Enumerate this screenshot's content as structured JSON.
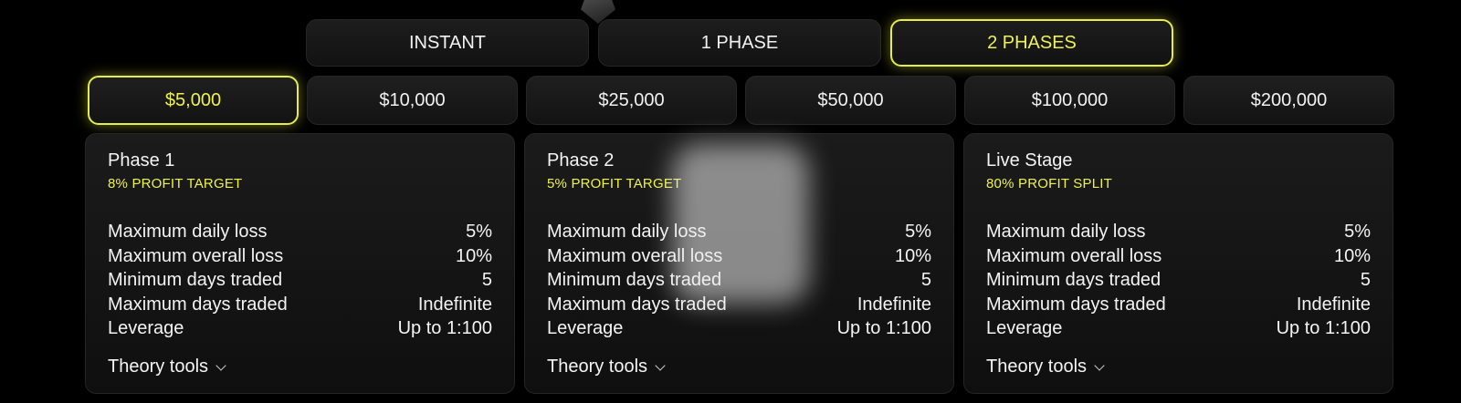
{
  "plan_tabs": [
    {
      "label": "INSTANT",
      "active": false
    },
    {
      "label": "1 PHASE",
      "active": false
    },
    {
      "label": "2 PHASES",
      "active": true
    }
  ],
  "amounts": [
    {
      "label": "$5,000",
      "active": true
    },
    {
      "label": "$10,000",
      "active": false
    },
    {
      "label": "$25,000",
      "active": false
    },
    {
      "label": "$50,000",
      "active": false
    },
    {
      "label": "$100,000",
      "active": false
    },
    {
      "label": "$200,000",
      "active": false
    }
  ],
  "cards": [
    {
      "title": "Phase 1",
      "subtitle": "8% PROFIT TARGET",
      "rows": [
        {
          "label": "Maximum daily loss",
          "value": "5%"
        },
        {
          "label": "Maximum overall loss",
          "value": "10%"
        },
        {
          "label": "Minimum days traded",
          "value": "5"
        },
        {
          "label": "Maximum days traded",
          "value": "Indefinite"
        },
        {
          "label": "Leverage",
          "value": "Up to 1:100"
        }
      ],
      "tools_label": "Theory tools"
    },
    {
      "title": "Phase 2",
      "subtitle": "5% PROFIT TARGET",
      "rows": [
        {
          "label": "Maximum daily loss",
          "value": "5%"
        },
        {
          "label": "Maximum overall loss",
          "value": "10%"
        },
        {
          "label": "Minimum days traded",
          "value": "5"
        },
        {
          "label": "Maximum days traded",
          "value": "Indefinite"
        },
        {
          "label": "Leverage",
          "value": "Up to 1:100"
        }
      ],
      "tools_label": "Theory tools"
    },
    {
      "title": "Live Stage",
      "subtitle": "80% PROFIT SPLIT",
      "rows": [
        {
          "label": "Maximum daily loss",
          "value": "5%"
        },
        {
          "label": "Maximum overall loss",
          "value": "10%"
        },
        {
          "label": "Minimum days traded",
          "value": "5"
        },
        {
          "label": "Maximum days traded",
          "value": "Indefinite"
        },
        {
          "label": "Leverage",
          "value": "Up to 1:100"
        }
      ],
      "tools_label": "Theory tools"
    }
  ],
  "colors": {
    "accent": "#e6ec4a",
    "background": "#000000",
    "card": "#161616"
  }
}
